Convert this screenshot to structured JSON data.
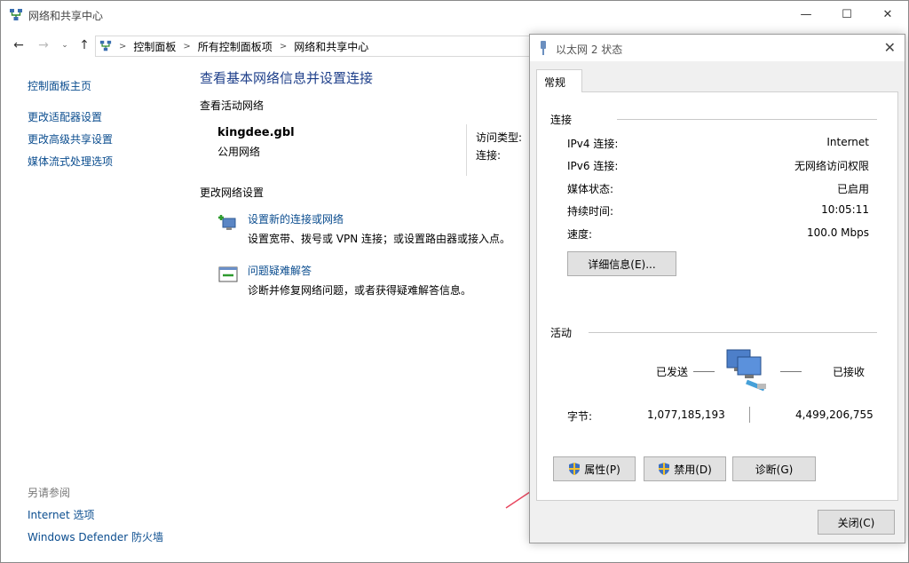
{
  "window": {
    "title": "网络和共享中心",
    "controls": {
      "minimize": "—",
      "maximize": "☐",
      "close": "✕"
    }
  },
  "address": {
    "crumbs": [
      "控制面板",
      "所有控制面板项",
      "网络和共享中心"
    ]
  },
  "sidebar": {
    "home": "控制面板主页",
    "items": [
      "更改适配器设置",
      "更改高级共享设置",
      "媒体流式处理选项"
    ]
  },
  "see_also": {
    "header": "另请参阅",
    "items": [
      "Internet 选项",
      "Windows Defender 防火墙"
    ]
  },
  "main": {
    "heading": "查看基本网络信息并设置连接",
    "active_networks_label": "查看活动网络",
    "network": {
      "name": "kingdee.gbl",
      "type": "公用网络",
      "access_type_label": "访问类型:",
      "connections_label": "连接:"
    },
    "change_settings_label": "更改网络设置",
    "tasks": [
      {
        "link": "设置新的连接或网络",
        "desc": "设置宽带、拨号或 VPN 连接；或设置路由器或接入点。"
      },
      {
        "link": "问题疑难解答",
        "desc": "诊断并修复网络问题，或者获得疑难解答信息。"
      }
    ]
  },
  "dialog": {
    "title": "以太网 2 状态",
    "tab": "常规",
    "connection_group": "连接",
    "rows": [
      {
        "k": "IPv4 连接:",
        "v": "Internet"
      },
      {
        "k": "IPv6 连接:",
        "v": "无网络访问权限"
      },
      {
        "k": "媒体状态:",
        "v": "已启用"
      },
      {
        "k": "持续时间:",
        "v": "10:05:11"
      },
      {
        "k": "速度:",
        "v": "100.0 Mbps"
      }
    ],
    "details_button": "详细信息(E)...",
    "activity_group": "活动",
    "sent_label": "已发送",
    "received_label": "已接收",
    "bytes_label": "字节:",
    "bytes_sent": "1,077,185,193",
    "bytes_received": "4,499,206,755",
    "properties_button": "属性(P)",
    "disable_button": "禁用(D)",
    "diagnose_button": "诊断(G)",
    "close_button": "关闭(C)"
  },
  "colors": {
    "link": "#0b4d8f",
    "heading": "#1e3f8a",
    "annotation_arrow": "#e8475f"
  }
}
